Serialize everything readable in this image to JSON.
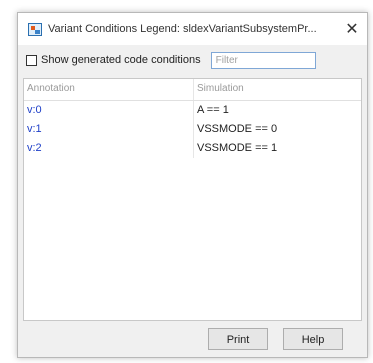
{
  "window": {
    "title": "Variant Conditions Legend: sldexVariantSubsystemPr...",
    "close_glyph": "✕"
  },
  "toolbar": {
    "checkbox_label": "Show generated code conditions",
    "checkbox_checked": false,
    "filter_placeholder": "Filter",
    "filter_value": ""
  },
  "table": {
    "headers": [
      "Annotation",
      "Simulation"
    ],
    "rows": [
      {
        "annotation": "v:0",
        "simulation": "A == 1"
      },
      {
        "annotation": "v:1",
        "simulation": "VSSMODE == 0"
      },
      {
        "annotation": "v:2",
        "simulation": "VSSMODE == 1"
      }
    ]
  },
  "buttons": {
    "print": "Print",
    "help": "Help"
  },
  "colors": {
    "annotation_link": "#1e3fc8",
    "filter_border": "#7fa7d6"
  },
  "icons": {
    "app": "variant-legend-icon",
    "close": "close-icon"
  }
}
